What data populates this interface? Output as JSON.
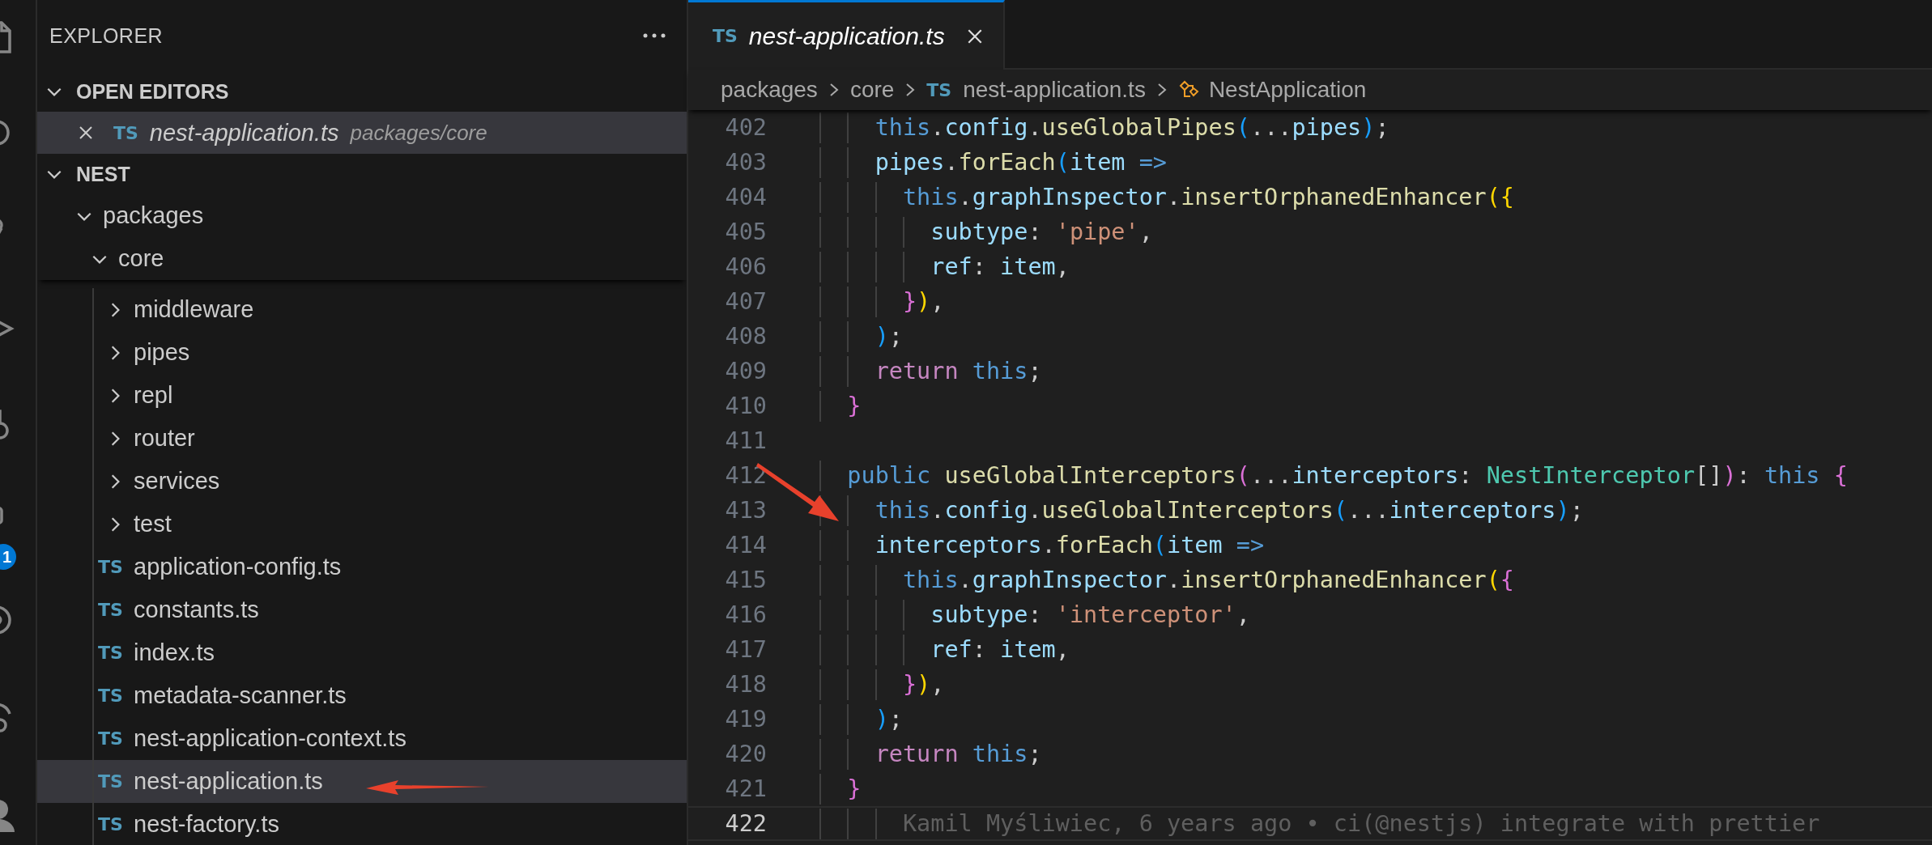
{
  "activity_bar": {
    "badge": "1"
  },
  "sidebar": {
    "title": "EXPLORER",
    "sections": [
      {
        "kind": "open_editors",
        "title": "OPEN EDITORS",
        "expanded": true,
        "editors": [
          {
            "icon_text": "TS",
            "name": "nest-application.ts",
            "description": "packages/core",
            "selected": true
          }
        ]
      },
      {
        "kind": "folder",
        "title": "NEST",
        "expanded": true,
        "children": [
          {
            "name": "packages",
            "kind": "folder",
            "expanded": true,
            "selected": false,
            "children": [
              {
                "name": "core",
                "kind": "folder",
                "expanded": true,
                "selected": false,
                "children": [
                  {
                    "name": "middleware",
                    "kind": "folder",
                    "expanded": false,
                    "selected": false
                  },
                  {
                    "name": "pipes",
                    "kind": "folder",
                    "expanded": false,
                    "selected": false
                  },
                  {
                    "name": "repl",
                    "kind": "folder",
                    "expanded": false,
                    "selected": false
                  },
                  {
                    "name": "router",
                    "kind": "folder",
                    "expanded": false,
                    "selected": false
                  },
                  {
                    "name": "services",
                    "kind": "folder",
                    "expanded": false,
                    "selected": false
                  },
                  {
                    "name": "test",
                    "kind": "folder",
                    "expanded": false,
                    "selected": false
                  },
                  {
                    "name": "application-config.ts",
                    "kind": "file",
                    "icon_text": "TS",
                    "selected": false
                  },
                  {
                    "name": "constants.ts",
                    "kind": "file",
                    "icon_text": "TS",
                    "selected": false
                  },
                  {
                    "name": "index.ts",
                    "kind": "file",
                    "icon_text": "TS",
                    "selected": false
                  },
                  {
                    "name": "metadata-scanner.ts",
                    "kind": "file",
                    "icon_text": "TS",
                    "selected": false
                  },
                  {
                    "name": "nest-application-context.ts",
                    "kind": "file",
                    "icon_text": "TS",
                    "selected": false
                  },
                  {
                    "name": "nest-application.ts",
                    "kind": "file",
                    "icon_text": "TS",
                    "selected": true
                  },
                  {
                    "name": "nest-factory.ts",
                    "kind": "file",
                    "icon_text": "TS",
                    "selected": false
                  }
                ]
              }
            ]
          }
        ]
      }
    ]
  },
  "editor": {
    "tabs": [
      {
        "icon_text": "TS",
        "label": "nest-application.ts",
        "selected": true,
        "preview": true
      }
    ],
    "breadcrumb": [
      {
        "kind": "folder",
        "label": "packages"
      },
      {
        "kind": "folder",
        "label": "core"
      },
      {
        "kind": "file",
        "icon_text": "TS",
        "label": "nest-application.ts"
      },
      {
        "kind": "symbol",
        "label": "NestApplication"
      }
    ],
    "lines": [
      {
        "number": "402",
        "current": false,
        "tokens": [
          {
            "text": "    this",
            "kind": "kw"
          },
          {
            "text": ".",
            "kind": "punc"
          },
          {
            "text": "config",
            "kind": "prop"
          },
          {
            "text": ".",
            "kind": "punc"
          },
          {
            "text": "useGlobalPipes",
            "kind": "fn"
          },
          {
            "text": "(",
            "kind": "br3"
          },
          {
            "text": "...",
            "kind": "punc"
          },
          {
            "text": "pipes",
            "kind": "prop"
          },
          {
            "text": ")",
            "kind": "br3"
          },
          {
            "text": ";",
            "kind": "punc"
          }
        ]
      },
      {
        "number": "403",
        "current": false,
        "tokens": [
          {
            "text": "    pipes",
            "kind": "prop"
          },
          {
            "text": ".",
            "kind": "punc"
          },
          {
            "text": "forEach",
            "kind": "fn"
          },
          {
            "text": "(",
            "kind": "br3"
          },
          {
            "text": "item",
            "kind": "prop"
          },
          {
            "text": " =>",
            "kind": "kw"
          }
        ]
      },
      {
        "number": "404",
        "current": false,
        "tokens": [
          {
            "text": "      this",
            "kind": "kw"
          },
          {
            "text": ".",
            "kind": "punc"
          },
          {
            "text": "graphInspector",
            "kind": "prop"
          },
          {
            "text": ".",
            "kind": "punc"
          },
          {
            "text": "insertOrphanedEnhancer",
            "kind": "fn"
          },
          {
            "text": "(",
            "kind": "br1"
          },
          {
            "text": "{",
            "kind": "br1"
          }
        ]
      },
      {
        "number": "405",
        "current": false,
        "tokens": [
          {
            "text": "        subtype",
            "kind": "prop"
          },
          {
            "text": ":",
            "kind": "punc"
          },
          {
            "text": " 'pipe'",
            "kind": "str"
          },
          {
            "text": ",",
            "kind": "punc"
          }
        ]
      },
      {
        "number": "406",
        "current": false,
        "tokens": [
          {
            "text": "        ref",
            "kind": "prop"
          },
          {
            "text": ":",
            "kind": "punc"
          },
          {
            "text": " item",
            "kind": "prop"
          },
          {
            "text": ",",
            "kind": "punc"
          }
        ]
      },
      {
        "number": "407",
        "current": false,
        "tokens": [
          {
            "text": "      }",
            "kind": "br2"
          },
          {
            "text": ")",
            "kind": "br1"
          },
          {
            "text": ",",
            "kind": "punc"
          }
        ]
      },
      {
        "number": "408",
        "current": false,
        "tokens": [
          {
            "text": "    )",
            "kind": "br3"
          },
          {
            "text": ";",
            "kind": "punc"
          }
        ]
      },
      {
        "number": "409",
        "current": false,
        "tokens": [
          {
            "text": "    return",
            "kind": "ctrl"
          },
          {
            "text": " this",
            "kind": "kw"
          },
          {
            "text": ";",
            "kind": "punc"
          }
        ]
      },
      {
        "number": "410",
        "current": false,
        "tokens": [
          {
            "text": "  }",
            "kind": "br2"
          }
        ]
      },
      {
        "number": "411",
        "current": false
      },
      {
        "number": "412",
        "current": false,
        "tokens": [
          {
            "text": "  public",
            "kind": "kw"
          },
          {
            "text": " useGlobalInterceptors",
            "kind": "fn"
          },
          {
            "text": "(",
            "kind": "br2"
          },
          {
            "text": "...",
            "kind": "punc"
          },
          {
            "text": "interceptors",
            "kind": "prop"
          },
          {
            "text": ":",
            "kind": "punc"
          },
          {
            "text": " NestInterceptor",
            "kind": "type"
          },
          {
            "text": "[]",
            "kind": "punc"
          },
          {
            "text": ")",
            "kind": "br2"
          },
          {
            "text": ":",
            "kind": "punc"
          },
          {
            "text": " this",
            "kind": "kw"
          },
          {
            "text": " {",
            "kind": "br2"
          }
        ]
      },
      {
        "number": "413",
        "current": false,
        "tokens": [
          {
            "text": "    this",
            "kind": "kw"
          },
          {
            "text": ".",
            "kind": "punc"
          },
          {
            "text": "config",
            "kind": "prop"
          },
          {
            "text": ".",
            "kind": "punc"
          },
          {
            "text": "useGlobalInterceptors",
            "kind": "fn"
          },
          {
            "text": "(",
            "kind": "br3"
          },
          {
            "text": "...",
            "kind": "punc"
          },
          {
            "text": "interceptors",
            "kind": "prop"
          },
          {
            "text": ")",
            "kind": "br3"
          },
          {
            "text": ";",
            "kind": "punc"
          }
        ]
      },
      {
        "number": "414",
        "current": false,
        "tokens": [
          {
            "text": "    interceptors",
            "kind": "prop"
          },
          {
            "text": ".",
            "kind": "punc"
          },
          {
            "text": "forEach",
            "kind": "fn"
          },
          {
            "text": "(",
            "kind": "br3"
          },
          {
            "text": "item",
            "kind": "prop"
          },
          {
            "text": " =>",
            "kind": "kw"
          }
        ]
      },
      {
        "number": "415",
        "current": false,
        "tokens": [
          {
            "text": "      this",
            "kind": "kw"
          },
          {
            "text": ".",
            "kind": "punc"
          },
          {
            "text": "graphInspector",
            "kind": "prop"
          },
          {
            "text": ".",
            "kind": "punc"
          },
          {
            "text": "insertOrphanedEnhancer",
            "kind": "fn"
          },
          {
            "text": "(",
            "kind": "br1"
          },
          {
            "text": "{",
            "kind": "br2"
          }
        ]
      },
      {
        "number": "416",
        "current": false,
        "tokens": [
          {
            "text": "        subtype",
            "kind": "prop"
          },
          {
            "text": ":",
            "kind": "punc"
          },
          {
            "text": " 'interceptor'",
            "kind": "str"
          },
          {
            "text": ",",
            "kind": "punc"
          }
        ]
      },
      {
        "number": "417",
        "current": false,
        "tokens": [
          {
            "text": "        ref",
            "kind": "prop"
          },
          {
            "text": ":",
            "kind": "punc"
          },
          {
            "text": " item",
            "kind": "prop"
          },
          {
            "text": ",",
            "kind": "punc"
          }
        ]
      },
      {
        "number": "418",
        "current": false,
        "tokens": [
          {
            "text": "      }",
            "kind": "br2"
          },
          {
            "text": ")",
            "kind": "br1"
          },
          {
            "text": ",",
            "kind": "punc"
          }
        ]
      },
      {
        "number": "419",
        "current": false,
        "tokens": [
          {
            "text": "    )",
            "kind": "br3"
          },
          {
            "text": ";",
            "kind": "punc"
          }
        ]
      },
      {
        "number": "420",
        "current": false,
        "tokens": [
          {
            "text": "    return",
            "kind": "ctrl"
          },
          {
            "text": " this",
            "kind": "kw"
          },
          {
            "text": ";",
            "kind": "punc"
          }
        ]
      },
      {
        "number": "421",
        "current": false,
        "tokens": [
          {
            "text": "  }",
            "kind": "br2"
          }
        ]
      },
      {
        "number": "422",
        "current": true,
        "tokens": [
          {
            "text": "      Kamil Myśliwiec, 6 years ago • ci(@nestjs) integrate with prettier",
            "kind": "blame"
          }
        ]
      }
    ]
  }
}
